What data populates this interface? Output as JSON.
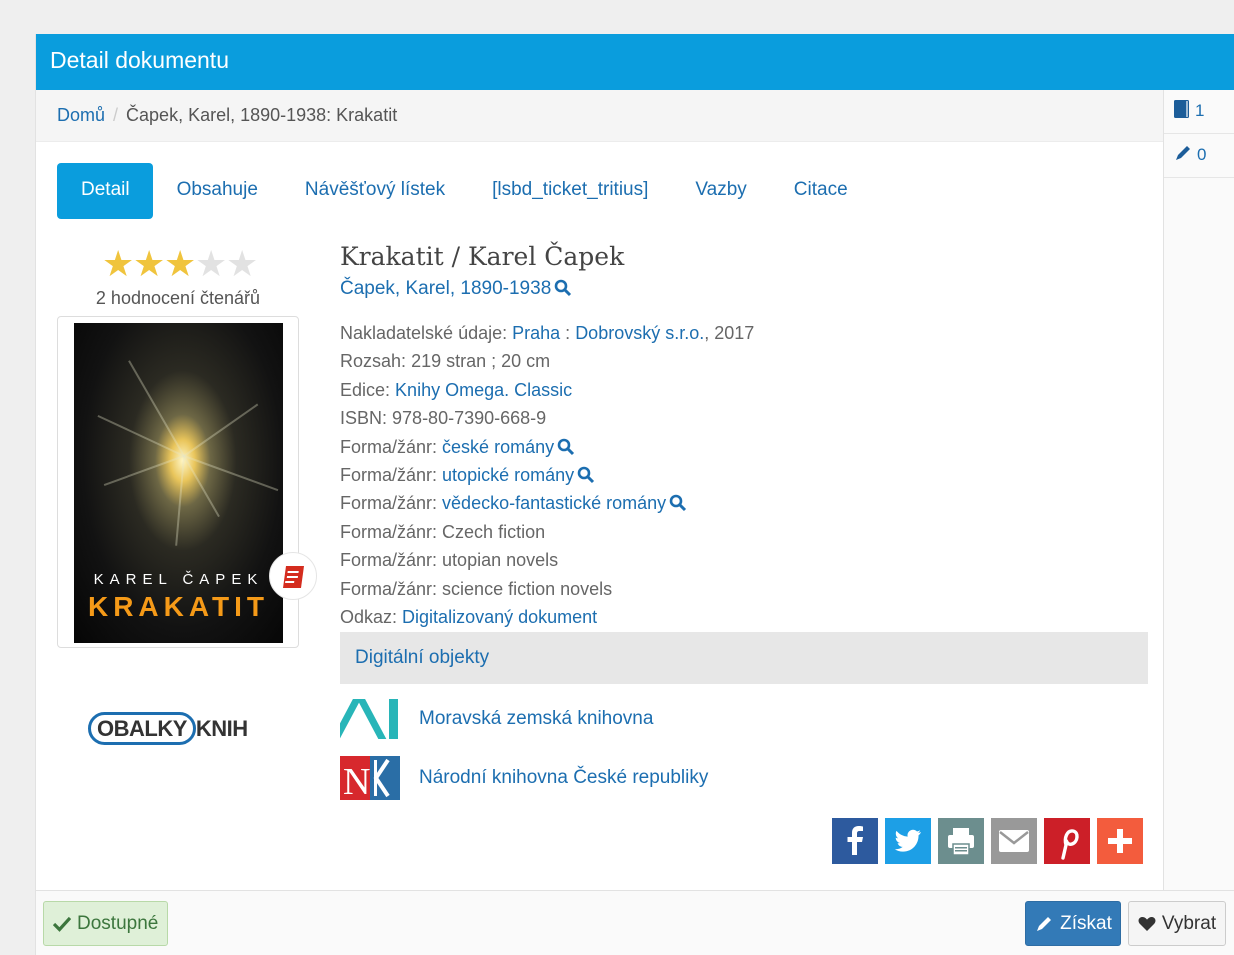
{
  "panel": {
    "title": "Detail dokumentu"
  },
  "breadcrumb": {
    "home": "Domů",
    "current": "Čapek, Karel, 1890-1938: Krakatit"
  },
  "counters": {
    "copies": "1",
    "edits": "0"
  },
  "tabs": [
    "Detail",
    "Obsahuje",
    "Návěšťový lístek",
    "[lsbd_ticket_tritius]",
    "Vazby",
    "Citace"
  ],
  "rating": {
    "value": 3,
    "max": 5,
    "text": "2 hodnocení čtenářů"
  },
  "cover": {
    "author": "KAREL ČAPEK",
    "title": "KRAKATIT",
    "source": "OBALKY",
    "source_suffix": "KNIH"
  },
  "record": {
    "title": "Krakatit / Karel Čapek",
    "author": "Čapek, Karel, 1890-1938",
    "publisher_label": "Nakladatelské údaje:",
    "publisher_place": "Praha",
    "publisher_name": "Dobrovský s.r.o.",
    "publisher_year": ", 2017",
    "extent_label": "Rozsah:",
    "extent": "219 stran ; 20 cm",
    "series_label": "Edice:",
    "series": "Knihy Omega. Classic",
    "isbn_label": "ISBN:",
    "isbn": "978-80-7390-668-9",
    "genre_label": "Forma/žánr:",
    "genres_linked": [
      "české romány",
      "utopické romány",
      "vědecko-fantastické romány"
    ],
    "genres_plain": [
      "Czech fiction",
      "utopian novels",
      "science fiction novels"
    ],
    "link_label": "Odkaz:",
    "link": "Digitalizovaný dokument"
  },
  "digital": {
    "heading": "Digitální objekty",
    "libraries": [
      "Moravská zemská knihovna",
      "Národní knihovna České republiky"
    ]
  },
  "share": [
    "facebook",
    "twitter",
    "print",
    "email",
    "pinterest",
    "more"
  ],
  "footer": {
    "status": "Dostupné",
    "get": "Získat",
    "pick": "Vybrat"
  },
  "colors": {
    "header": "#0a9ddd",
    "link": "#1c6eb0",
    "star": "#f0c43d",
    "facebook": "#2d5a9e",
    "twitter": "#1d9fe6",
    "print": "#6c8e8e",
    "email": "#999999",
    "pinterest": "#cc1f28",
    "more": "#f35c3d"
  }
}
